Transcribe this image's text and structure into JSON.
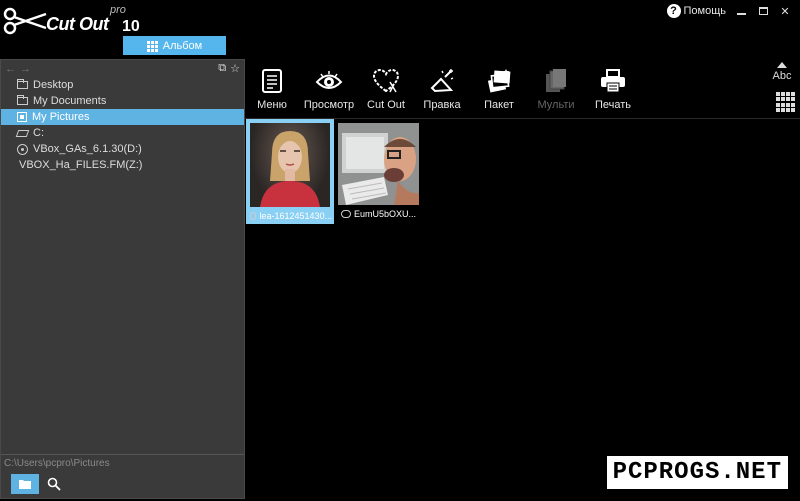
{
  "app": {
    "brand": "Cut Out",
    "edition": "pro",
    "version": "10",
    "album_label": "Альбом"
  },
  "window": {
    "help_label": "Помощь",
    "minimize": "–",
    "maximize": "□",
    "close": "✕"
  },
  "sidebar": {
    "toolbar": {
      "back": "←",
      "forward": "→",
      "new_folder": "⧉",
      "favorite": "☆"
    },
    "items": [
      {
        "label": "Desktop",
        "icon": "folder-icon"
      },
      {
        "label": "My Documents",
        "icon": "folder-icon"
      },
      {
        "label": "My Pictures",
        "icon": "pictures-icon",
        "selected": true
      },
      {
        "label": "C:",
        "icon": "drive-icon"
      },
      {
        "label": "VBox_GAs_6.1.30(D:)",
        "icon": "cd-icon"
      },
      {
        "label": "VBOX_Ha_FILES.FM(Z:)",
        "icon": "none"
      }
    ],
    "path": "C:\\Users\\pcpro\\Pictures"
  },
  "toolbar": {
    "menu": "Меню",
    "preview": "Просмотр",
    "cutout": "Cut Out",
    "edit": "Правка",
    "batch": "Пакет",
    "multi": "Мульти",
    "print": "Печать",
    "sort_label": "Abc"
  },
  "thumbnails": [
    {
      "caption": "lea-1612451430...",
      "selected": true
    },
    {
      "caption": "EumU5bOXU...",
      "selected": false
    }
  ],
  "watermark": "PCPROGS.NET",
  "colors": {
    "accent": "#54b6ec",
    "selection": "#5fb3e3",
    "panel": "#3a3a3a",
    "background": "#000000"
  }
}
